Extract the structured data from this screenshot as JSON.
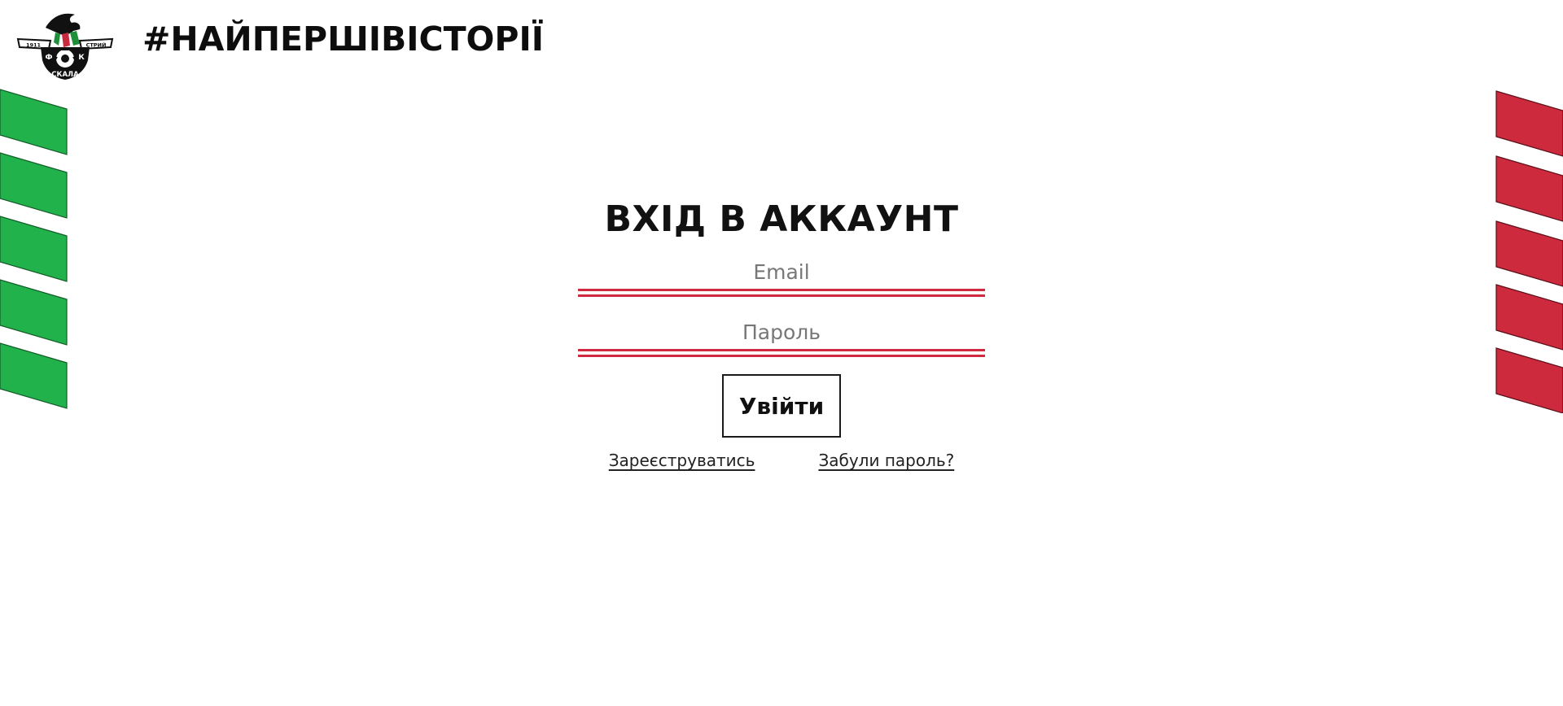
{
  "header": {
    "logo": {
      "icon": "fk-skala-crest-icon",
      "year": "1911",
      "city": "СТРИЙ",
      "letter_left": "Ф",
      "letter_right": "К",
      "club_name": "СКАЛА"
    },
    "hashtag": "#НАЙПЕРШІВІСТОРІЇ"
  },
  "colors": {
    "green": "#22b24c",
    "red": "#cd2a3e",
    "rule_red": "#cf2a3f",
    "text": "#111111"
  },
  "login": {
    "title": "ВХІД В АККАУНТ",
    "email_placeholder": "Email",
    "password_placeholder": "Пароль",
    "submit_label": "Увійти",
    "register_link": "Зареєструватись",
    "forgot_link": "Забули пароль?"
  }
}
